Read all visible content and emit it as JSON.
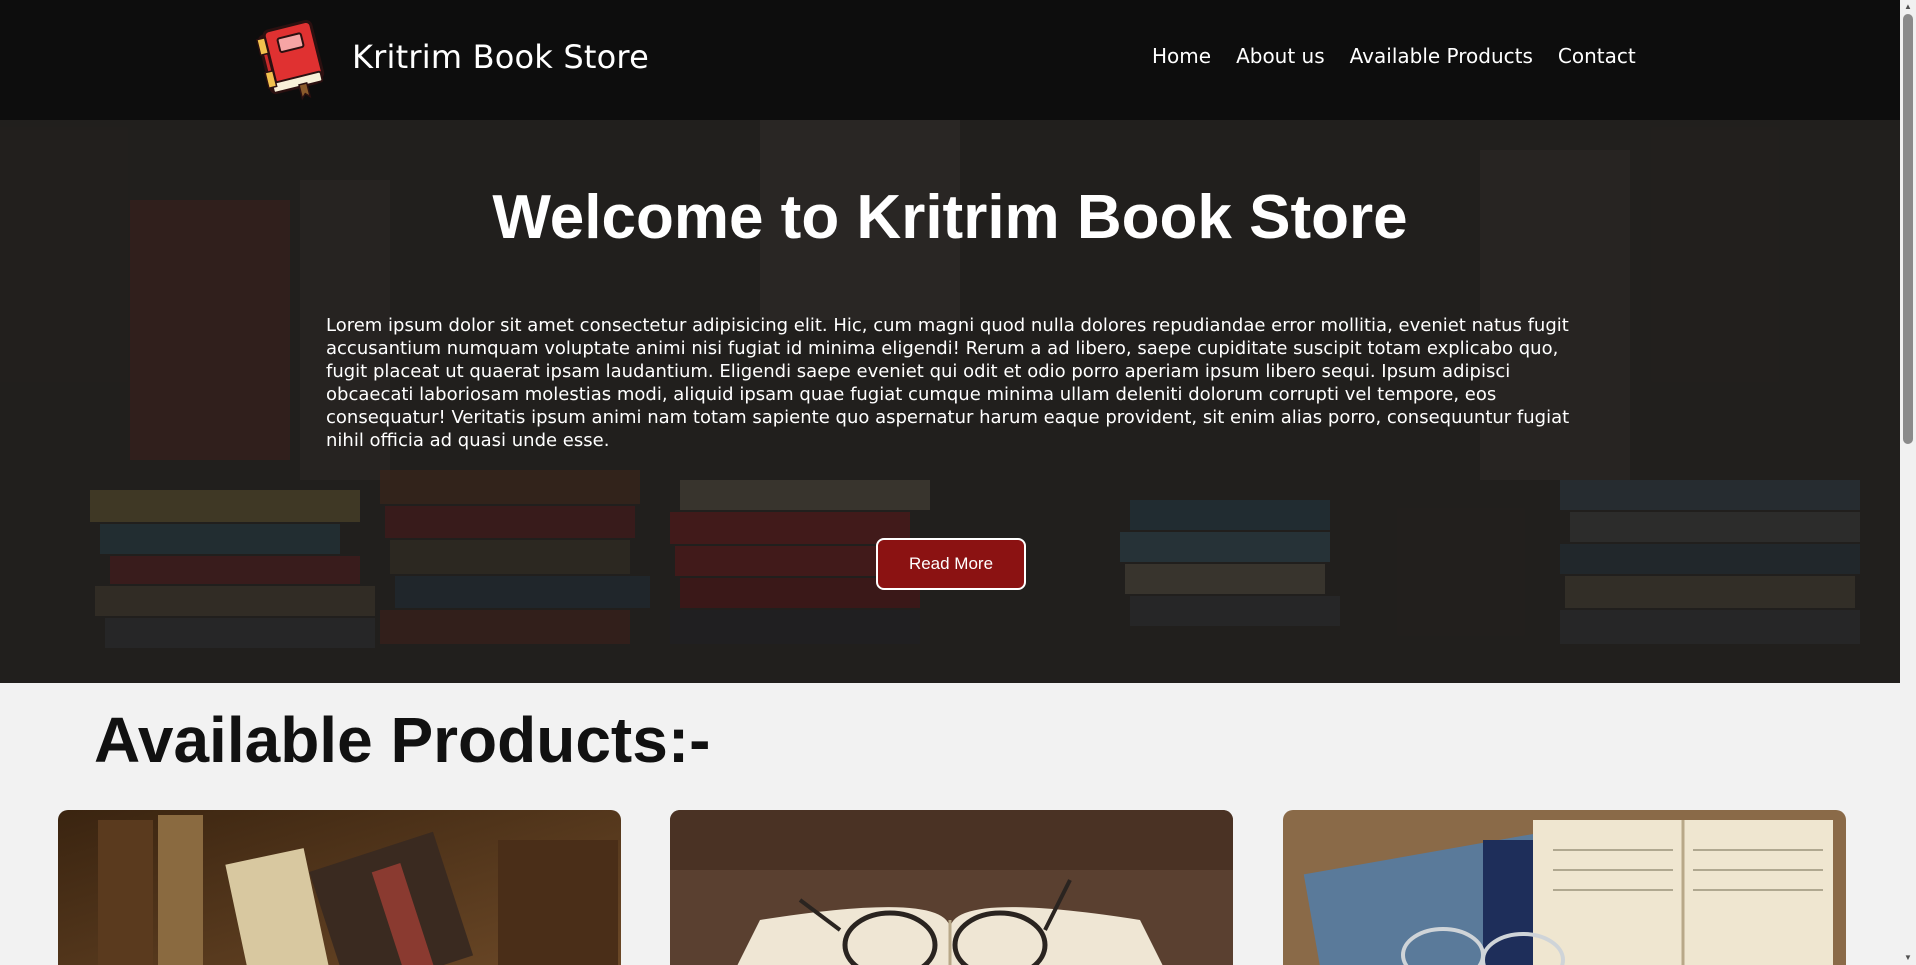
{
  "brand": {
    "name": "Kritrim Book Store",
    "logo_icon": "red-book-icon"
  },
  "nav": {
    "items": [
      "Home",
      "About us",
      "Available Products",
      "Contact"
    ]
  },
  "hero": {
    "title": "Welcome to Kritrim Book Store",
    "text": "Lorem ipsum dolor sit amet consectetur adipisicing elit. Hic, cum magni quod nulla dolores repudiandae error mollitia, eveniet natus fugit accusantium numquam voluptate animi nisi fugiat id minima eligendi! Rerum a ad libero, saepe cupiditate suscipit totam explicabo quo, fugit placeat ut quaerat ipsam laudantium. Eligendi saepe eveniet qui odit et odio porro aperiam ipsum libero sequi. Ipsum adipisci obcaecati laboriosam molestias modi, aliquid ipsam quae fugiat cumque minima ullam deleniti dolorum corrupti vel tempore, eos consequatur! Veritatis ipsum animi nam totam sapiente quo aspernatur harum eaque provident, sit enim alias porro, consequuntur fugiat nihil officia ad quasi unde esse.",
    "button": "Read More"
  },
  "products": {
    "heading": "Available Products:-"
  },
  "colors": {
    "navbar": "#0d0d0d",
    "button": "#8b1212",
    "page_bg": "#f2f2f2"
  }
}
